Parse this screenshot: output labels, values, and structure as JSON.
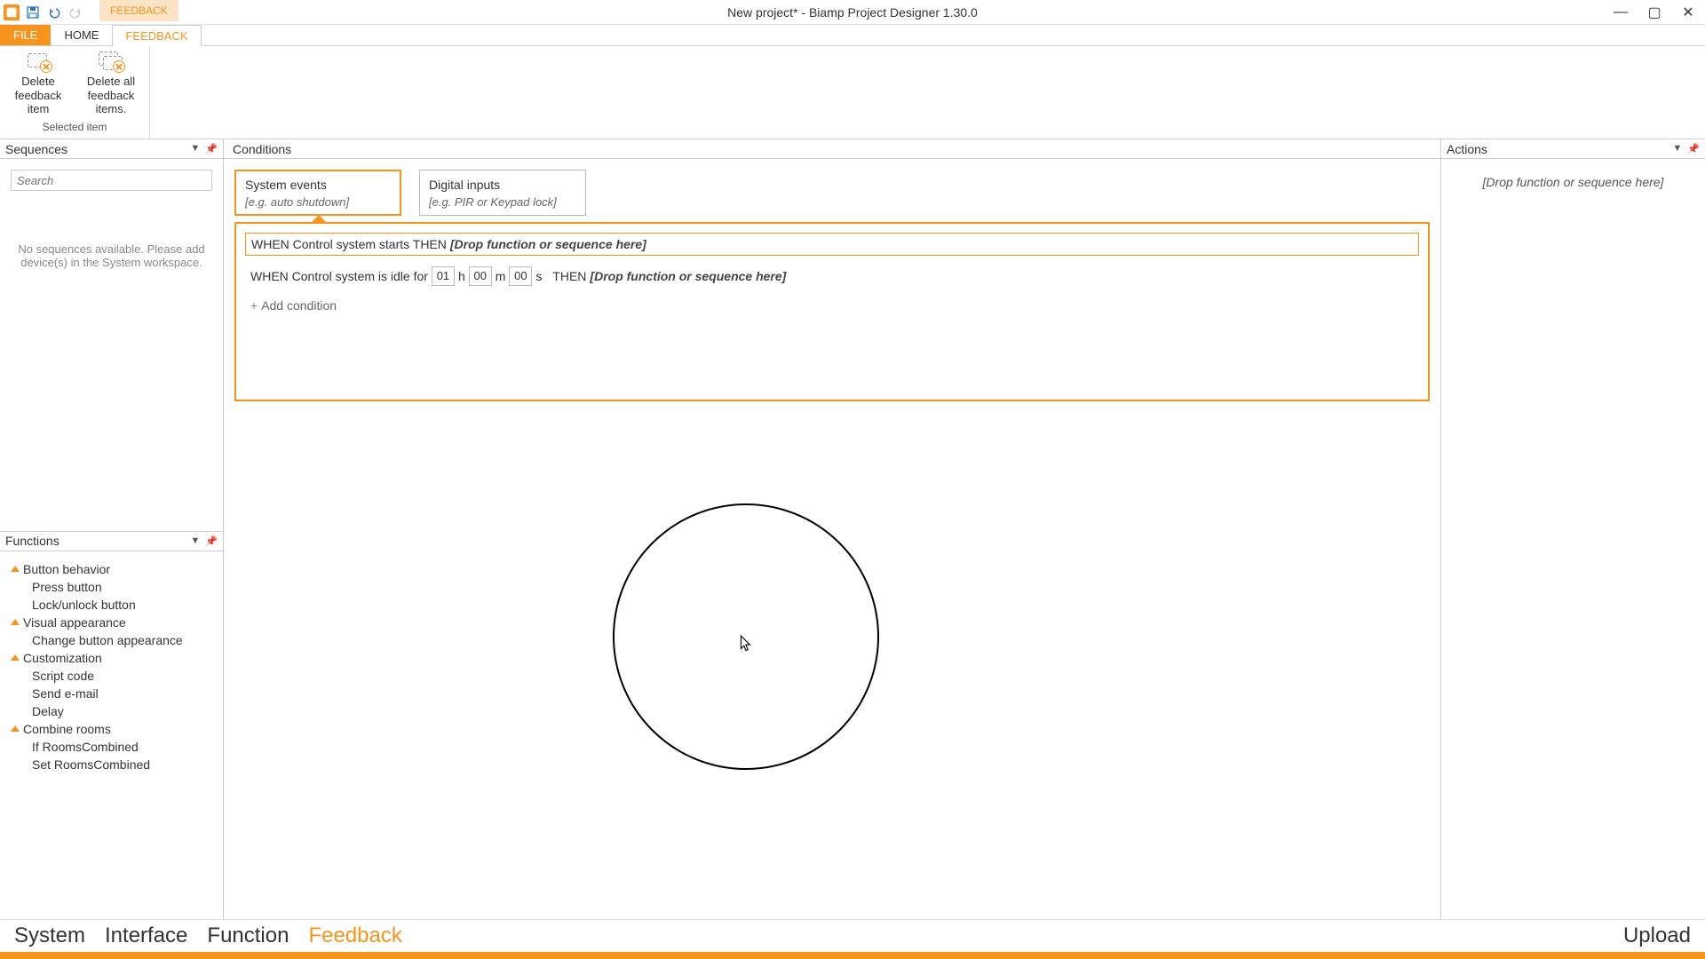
{
  "window": {
    "title": "New project* - Biamp Project Designer 1.30.0",
    "context_tab": "FEEDBACK"
  },
  "qat": {
    "save": "save-icon",
    "undo": "undo-icon",
    "redo": "redo-icon"
  },
  "ribbon": {
    "tabs": {
      "file": "FILE",
      "home": "HOME",
      "feedback": "FEEDBACK"
    },
    "group_label": "Selected item",
    "buttons": {
      "delete_item": "Delete feedback item",
      "delete_all": "Delete all feedback items."
    }
  },
  "sequences": {
    "title": "Sequences",
    "search_placeholder": "Search",
    "empty": "No sequences available. Please add device(s) in the System workspace."
  },
  "functions": {
    "title": "Functions",
    "groups": [
      {
        "name": "Button behavior",
        "items": [
          "Press button",
          "Lock/unlock button"
        ]
      },
      {
        "name": "Visual appearance",
        "items": [
          "Change button appearance"
        ]
      },
      {
        "name": "Customization",
        "items": [
          "Script code",
          "Send e-mail",
          "Delay"
        ]
      },
      {
        "name": "Combine rooms",
        "items": [
          "If RoomsCombined",
          "Set RoomsCombined"
        ]
      }
    ]
  },
  "conditions": {
    "title": "Conditions",
    "tabs": [
      {
        "title": "System events",
        "hint": "[e.g. auto shutdown]",
        "active": true
      },
      {
        "title": "Digital inputs",
        "hint": "[e.g. PIR or Keypad lock]",
        "active": false
      }
    ],
    "rules": {
      "r1_prefix": "WHEN Control system starts THEN",
      "r1_drop": "[Drop function or sequence here]",
      "r2_prefix": "WHEN Control system is idle for",
      "r2_h": "01",
      "r2_h_u": "h",
      "r2_m": "00",
      "r2_m_u": "m",
      "r2_s": "00",
      "r2_s_u": "s",
      "r2_then": "THEN",
      "r2_drop": "[Drop function or sequence here]"
    },
    "add": "Add condition"
  },
  "actions": {
    "title": "Actions",
    "drop_hint": "[Drop function or sequence here]"
  },
  "bottom": {
    "tabs": [
      "System",
      "Interface",
      "Function",
      "Feedback"
    ],
    "active": "Feedback",
    "upload": "Upload"
  },
  "colors": {
    "accent": "#f7941e"
  }
}
